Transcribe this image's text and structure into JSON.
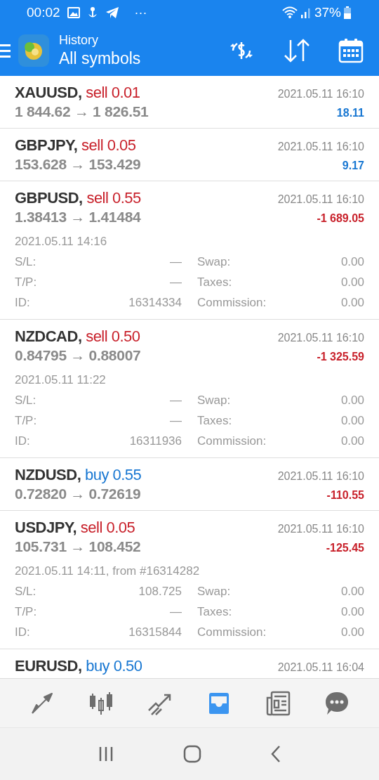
{
  "status_bar": {
    "time": "00:02",
    "more": "···",
    "battery": "37%"
  },
  "app_bar": {
    "title": "History",
    "subtitle": "All symbols"
  },
  "trades": [
    {
      "symbol": "XAUUSD,",
      "side": {
        "kind": "sell",
        "text": "sell 0.01"
      },
      "prices": "1 844.62 → 1 826.51",
      "time": "2021.05.11 16:10",
      "profit": {
        "kind": "gain",
        "text": "18.11"
      }
    },
    {
      "symbol": "GBPJPY,",
      "side": {
        "kind": "sell",
        "text": "sell 0.05"
      },
      "prices": "153.628 → 153.429",
      "time": "2021.05.11 16:10",
      "profit": {
        "kind": "gain",
        "text": "9.17"
      }
    },
    {
      "symbol": "GBPUSD,",
      "side": {
        "kind": "sell",
        "text": "sell 0.55"
      },
      "prices": "1.38413 → 1.41484",
      "time": "2021.05.11 16:10",
      "profit": {
        "kind": "loss",
        "text": "-1 689.05"
      },
      "details": {
        "open_time": "2021.05.11 14:16",
        "rows": [
          {
            "label": "S/L:",
            "value": "—",
            "label2": "Swap:",
            "value2": "0.00"
          },
          {
            "label": "T/P:",
            "value": "—",
            "label2": "Taxes:",
            "value2": "0.00"
          },
          {
            "label": "ID:",
            "value": "16314334",
            "label2": "Commission:",
            "value2": "0.00"
          }
        ]
      }
    },
    {
      "symbol": "NZDCAD,",
      "side": {
        "kind": "sell",
        "text": "sell 0.50"
      },
      "prices": "0.84795 → 0.88007",
      "time": "2021.05.11 16:10",
      "profit": {
        "kind": "loss",
        "text": "-1 325.59"
      },
      "details": {
        "open_time": "2021.05.11 11:22",
        "rows": [
          {
            "label": "S/L:",
            "value": "—",
            "label2": "Swap:",
            "value2": "0.00"
          },
          {
            "label": "T/P:",
            "value": "—",
            "label2": "Taxes:",
            "value2": "0.00"
          },
          {
            "label": "ID:",
            "value": "16311936",
            "label2": "Commission:",
            "value2": "0.00"
          }
        ]
      }
    },
    {
      "symbol": "NZDUSD,",
      "side": {
        "kind": "buy",
        "text": "buy 0.55"
      },
      "prices": "0.72820 → 0.72619",
      "time": "2021.05.11 16:10",
      "profit": {
        "kind": "loss",
        "text": "-110.55"
      }
    },
    {
      "symbol": "USDJPY,",
      "side": {
        "kind": "sell",
        "text": "sell 0.05"
      },
      "prices": "105.731 → 108.452",
      "time": "2021.05.11 16:10",
      "profit": {
        "kind": "loss",
        "text": "-125.45"
      },
      "details": {
        "open_time": "2021.05.11 14:11, from #16314282",
        "rows": [
          {
            "label": "S/L:",
            "value": "108.725",
            "label2": "Swap:",
            "value2": "0.00"
          },
          {
            "label": "T/P:",
            "value": "—",
            "label2": "Taxes:",
            "value2": "0.00"
          },
          {
            "label": "ID:",
            "value": "16315844",
            "label2": "Commission:",
            "value2": "0.00"
          }
        ]
      }
    },
    {
      "symbol": "EURUSD,",
      "side": {
        "kind": "buy",
        "text": "buy 0.50"
      },
      "time": "2021.05.11 16:04"
    }
  ],
  "bottom_nav": [
    {
      "kind": "quotes",
      "selected": false
    },
    {
      "kind": "chart",
      "selected": false
    },
    {
      "kind": "trade",
      "selected": false
    },
    {
      "kind": "history",
      "selected": true
    },
    {
      "kind": "news",
      "selected": false
    },
    {
      "kind": "chat",
      "selected": false
    }
  ]
}
